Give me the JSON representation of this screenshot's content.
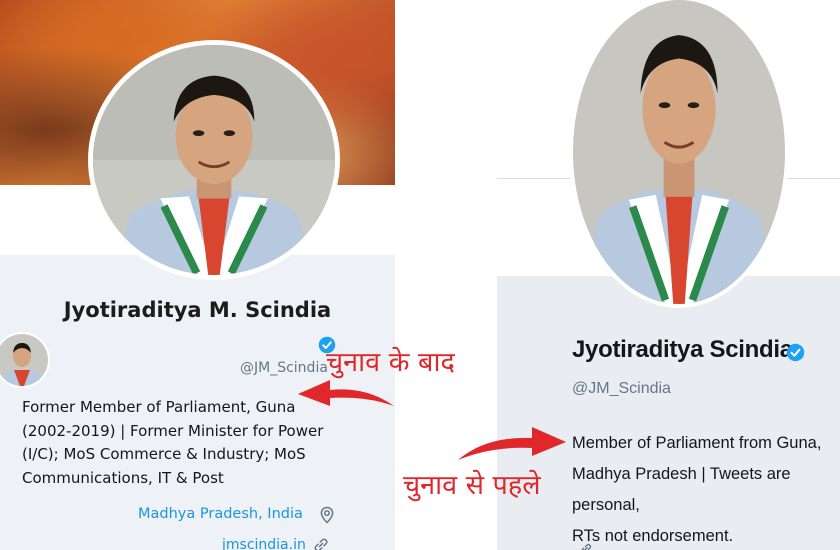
{
  "left_profile": {
    "name": "Jyotiraditya M. Scindia",
    "handle": "@JM_Scindia",
    "bio": "Former Member of Parliament, Guna\n(2002-2019) | Former Minister for Power\n(I/C); MoS Commerce & Industry; MoS\nCommunications, IT & Post",
    "location": "Madhya Pradesh, India",
    "website": "jmscindia.in"
  },
  "right_profile": {
    "name": "Jyotiraditya Scindia",
    "handle": "@JM_Scindia",
    "bio": "Member of Parliament from Guna,\nMadhya Pradesh | Tweets are personal,\nRTs not endorsement."
  },
  "annotations": {
    "after_label": "चुनाव के बाद",
    "before_label": "चुनाव से पहले"
  },
  "icons": {
    "verified": "verified-badge-icon",
    "location": "location-pin-icon",
    "link": "link-icon"
  },
  "colors": {
    "link_blue": "#1b95e0",
    "verified_blue": "#1da1f2",
    "annotation_red": "#e0282b",
    "muted_gray": "#657786"
  }
}
